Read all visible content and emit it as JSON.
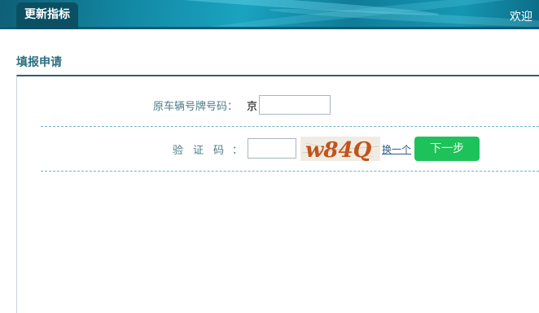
{
  "header": {
    "active_tab": "更新指标",
    "welcome": "欢迎"
  },
  "section": {
    "title": "填报申请"
  },
  "form": {
    "plate_label": "原车辆号牌号码：",
    "plate_prefix": "京",
    "plate_value": "",
    "captcha_label": "验证码",
    "captcha_colon": "：",
    "captcha_value": "",
    "captcha_text": "w84Q",
    "refresh_link": "换一个",
    "next_button": "下一步"
  },
  "colors": {
    "header_dark": "#0b4f63",
    "accent_text": "#4c7c86",
    "button_green": "#1ec25a",
    "captcha_text": "#c0531c"
  }
}
